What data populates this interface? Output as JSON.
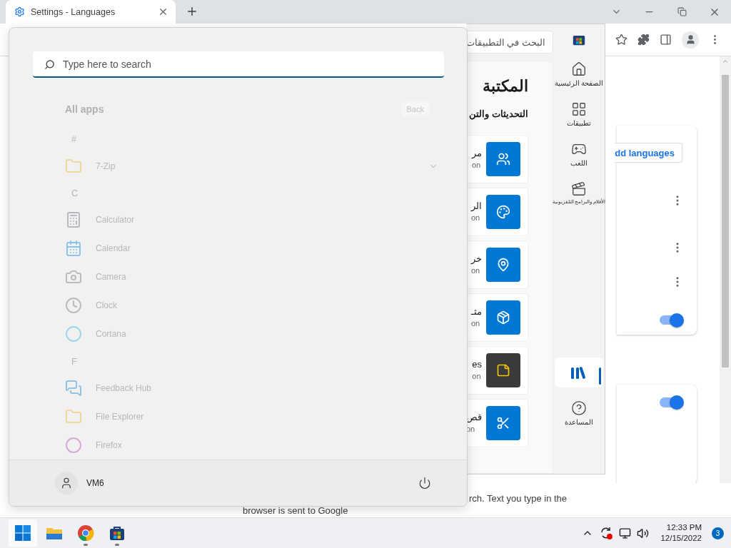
{
  "browser": {
    "tab": {
      "title": "Settings - Languages",
      "selected": true
    },
    "add_languages_button": "dd languages",
    "toggles": [
      {
        "on": true
      },
      {
        "on": true
      }
    ],
    "footer_lines": [
      "rch. Text you type in the",
      "browser is sent to Google"
    ]
  },
  "store": {
    "search": {
      "placeholder": "البحث في التطبيقات"
    },
    "heading": "المكتبة",
    "subheading": "التحديثات والتن",
    "apps": [
      {
        "name": "مر",
        "subtitle": "on",
        "kind": "people",
        "color": "#0078d4"
      },
      {
        "name": "الر",
        "subtitle": "on",
        "kind": "paint",
        "color": "#0078d4"
      },
      {
        "name": "خر",
        "subtitle": "on",
        "kind": "map",
        "color": "#0078d4"
      },
      {
        "name": "مثـ",
        "subtitle": "on",
        "kind": "box",
        "color": "#0078d4"
      },
      {
        "name": "es",
        "subtitle": "on",
        "kind": "note",
        "color": "#3a3a3a"
      },
      {
        "name": "قص",
        "subtitle": "on",
        "kind": "snip",
        "color": "#0078d4"
      }
    ],
    "nav": [
      {
        "kind": "home",
        "label": "الصفحة الرئيسية",
        "selected": false
      },
      {
        "kind": "apps",
        "label": "تطبيقات",
        "selected": false
      },
      {
        "kind": "gaming",
        "label": "اللعب",
        "selected": false
      },
      {
        "kind": "movies",
        "label": "الأفلام والبرامج التلفزيونية",
        "selected": false
      },
      {
        "kind": "library",
        "selected": true
      },
      {
        "kind": "help",
        "label": "المساعدة",
        "selected": false
      }
    ]
  },
  "start_menu": {
    "search": {
      "placeholder": "Type here to search"
    },
    "heading": "All apps",
    "back_button": "Back",
    "groups": [
      {
        "letter": "#",
        "apps": [
          {
            "name": "7-Zip",
            "kind": "folder",
            "expandable": true
          }
        ]
      },
      {
        "letter": "C",
        "apps": [
          {
            "name": "Calculator",
            "kind": "calculator",
            "expandable": false
          },
          {
            "name": "Calendar",
            "kind": "calendar",
            "expandable": false
          },
          {
            "name": "Camera",
            "kind": "camera",
            "expandable": false
          },
          {
            "name": "Clock",
            "kind": "clock",
            "expandable": false
          },
          {
            "name": "Cortana",
            "kind": "cortana",
            "expandable": false
          }
        ]
      },
      {
        "letter": "F",
        "apps": [
          {
            "name": "Feedback Hub",
            "kind": "feedback",
            "expandable": false
          },
          {
            "name": "File Explorer",
            "kind": "explorer",
            "expandable": false
          },
          {
            "name": "Firefox",
            "kind": "firefox",
            "expandable": false
          }
        ]
      }
    ],
    "user": {
      "name": "VM6"
    }
  },
  "taskbar": {
    "apps": [
      {
        "kind": "start",
        "selected": true,
        "running": false
      },
      {
        "kind": "explorer",
        "selected": false,
        "running": false
      },
      {
        "kind": "chrome",
        "selected": false,
        "running": true
      },
      {
        "kind": "store",
        "selected": false,
        "running": true
      }
    ],
    "time": "12:33 PM",
    "date": "12/15/2022",
    "notifications": "3"
  }
}
